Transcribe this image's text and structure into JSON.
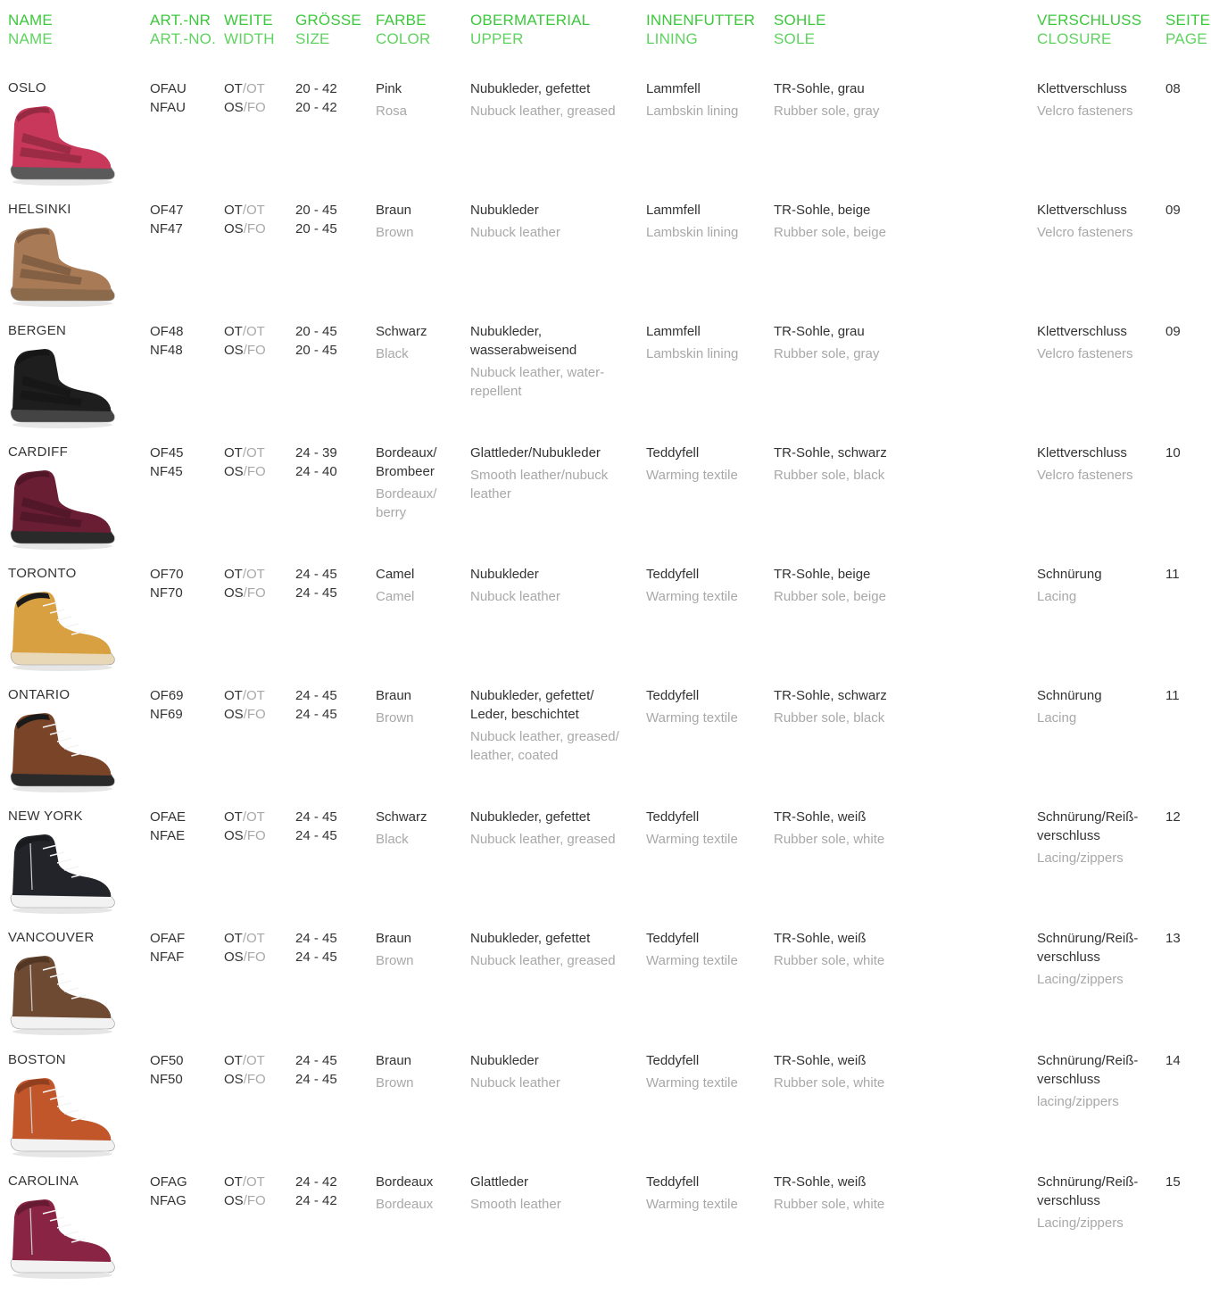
{
  "headers": {
    "name": {
      "de": "NAME",
      "en": "NAME"
    },
    "art": {
      "de": "ART.-NR",
      "en": "ART.-NO."
    },
    "width": {
      "de": "WEITE",
      "en": "WIDTH"
    },
    "size": {
      "de": "GRÖSSE",
      "en": "SIZE"
    },
    "color": {
      "de": "FARBE",
      "en": "COLOR"
    },
    "upper": {
      "de": "OBERMATERIAL",
      "en": "UPPER"
    },
    "lining": {
      "de": "INNENFUTTER",
      "en": "LINING"
    },
    "sole": {
      "de": "SOHLE",
      "en": "SOLE"
    },
    "closure": {
      "de": "VERSCHLUSS",
      "en": "CLOSURE"
    },
    "page": {
      "de": "SEITE",
      "en": "PAGE"
    }
  },
  "width_labels": {
    "ot_a": "OT",
    "ot_b": "OT",
    "os_a": "OS",
    "os_b": "FO",
    "slash": "/"
  },
  "products": [
    {
      "name": "OSLO",
      "art1": "OFAU",
      "art2": "NFAU",
      "size1": "20 - 42",
      "size2": "20 - 42",
      "color_de": "Pink",
      "color_en": "Rosa",
      "upper_de": "Nubukleder, gefettet",
      "upper_en": "Nubuck leather, greased",
      "lining_de": "Lammfell",
      "lining_en": "Lambskin lining",
      "sole_de": "TR-Sohle, grau",
      "sole_en": "Rubber sole, gray",
      "closure_de": "Klettverschluss",
      "closure_en": "Velcro fasteners",
      "page": "08",
      "shoe_color": "#c8385a",
      "sole_color": "#5a5a5a",
      "style": "velcro"
    },
    {
      "name": "HELSINKI",
      "art1": "OF47",
      "art2": "NF47",
      "size1": "20 - 45",
      "size2": "20 - 45",
      "color_de": "Braun",
      "color_en": "Brown",
      "upper_de": "Nubukleder",
      "upper_en": "Nubuck leather",
      "lining_de": "Lammfell",
      "lining_en": "Lambskin lining",
      "sole_de": "TR-Sohle, beige",
      "sole_en": "Rubber sole, beige",
      "closure_de": "Klettverschluss",
      "closure_en": "Velcro fasteners",
      "page": "09",
      "shoe_color": "#a87a56",
      "sole_color": "#8a6a4a",
      "style": "velcro"
    },
    {
      "name": "BERGEN",
      "art1": "OF48",
      "art2": "NF48",
      "size1": "20 - 45",
      "size2": "20 - 45",
      "color_de": "Schwarz",
      "color_en": "Black",
      "upper_de": "Nubukleder, wasserabweisend",
      "upper_en": "Nubuck leather, water-repellent",
      "lining_de": "Lammfell",
      "lining_en": "Lambskin lining",
      "sole_de": "TR-Sohle, grau",
      "sole_en": "Rubber sole, gray",
      "closure_de": "Klettverschluss",
      "closure_en": "Velcro fasteners",
      "page": "09",
      "shoe_color": "#1e1e1e",
      "sole_color": "#444444",
      "style": "velcro"
    },
    {
      "name": "CARDIFF",
      "art1": "OF45",
      "art2": "NF45",
      "size1": "24 - 39",
      "size2": "24 - 40",
      "color_de": "Bordeaux/ Brombeer",
      "color_en": "Bordeaux/ berry",
      "upper_de": "Glattleder/Nubukleder",
      "upper_en": "Smooth leather/nubuck leather",
      "lining_de": "Teddyfell",
      "lining_en": "Warming textile",
      "sole_de": "TR-Sohle, schwarz",
      "sole_en": "Rubber sole, black",
      "closure_de": "Klettverschluss",
      "closure_en": "Velcro fasteners",
      "page": "10",
      "shoe_color": "#6a1e34",
      "sole_color": "#2a2a2a",
      "style": "velcro"
    },
    {
      "name": "TORONTO",
      "art1": "OF70",
      "art2": "NF70",
      "size1": "24 - 45",
      "size2": "24 - 45",
      "color_de": "Camel",
      "color_en": "Camel",
      "upper_de": "Nubukleder",
      "upper_en": "Nubuck leather",
      "lining_de": "Teddyfell",
      "lining_en": "Warming textile",
      "sole_de": "TR-Sohle, beige",
      "sole_en": "Rubber sole, beige",
      "closure_de": "Schnürung",
      "closure_en": "Lacing",
      "page": "11",
      "shoe_color": "#d8a040",
      "sole_color": "#e8d8b8",
      "style": "lace"
    },
    {
      "name": "ONTARIO",
      "art1": "OF69",
      "art2": "NF69",
      "size1": "24 - 45",
      "size2": "24 - 45",
      "color_de": "Braun",
      "color_en": "Brown",
      "upper_de": "Nubukleder, gefettet/ Leder, beschichtet",
      "upper_en": "Nubuck leather, greased/ leather, coated",
      "lining_de": "Teddyfell",
      "lining_en": "Warming textile",
      "sole_de": "TR-Sohle, schwarz",
      "sole_en": "Rubber sole, black",
      "closure_de": "Schnürung",
      "closure_en": "Lacing",
      "page": "11",
      "shoe_color": "#7a4428",
      "sole_color": "#2a2a2a",
      "style": "lace"
    },
    {
      "name": "NEW YORK",
      "art1": "OFAE",
      "art2": "NFAE",
      "size1": "24 - 45",
      "size2": "24 - 45",
      "color_de": "Schwarz",
      "color_en": "Black",
      "upper_de": "Nubukleder, gefettet",
      "upper_en": "Nubuck leather, greased",
      "lining_de": "Teddyfell",
      "lining_en": "Warming textile",
      "sole_de": "TR-Sohle, weiß",
      "sole_en": "Rubber sole, white",
      "closure_de": "Schnürung/Reiß- verschluss",
      "closure_en": "Lacing/zippers",
      "page": "12",
      "shoe_color": "#22242a",
      "sole_color": "#f2f2f2",
      "style": "sneaker"
    },
    {
      "name": "VANCOUVER",
      "art1": "OFAF",
      "art2": "NFAF",
      "size1": "24 - 45",
      "size2": "24 - 45",
      "color_de": "Braun",
      "color_en": "Brown",
      "upper_de": "Nubukleder, gefettet",
      "upper_en": "Nubuck leather, greased",
      "lining_de": "Teddyfell",
      "lining_en": "Warming textile",
      "sole_de": "TR-Sohle, weiß",
      "sole_en": "Rubber sole, white",
      "closure_de": "Schnürung/Reiß- verschluss",
      "closure_en": "Lacing/zippers",
      "page": "13",
      "shoe_color": "#6e4a32",
      "sole_color": "#f2f2f2",
      "style": "sneaker"
    },
    {
      "name": "BOSTON",
      "art1": "OF50",
      "art2": "NF50",
      "size1": "24 - 45",
      "size2": "24 - 45",
      "color_de": "Braun",
      "color_en": "Brown",
      "upper_de": "Nubukleder",
      "upper_en": "Nubuck leather",
      "lining_de": "Teddyfell",
      "lining_en": "Warming textile",
      "sole_de": "TR-Sohle, weiß",
      "sole_en": "Rubber sole, white",
      "closure_de": "Schnürung/Reiß- verschluss",
      "closure_en": "lacing/zippers",
      "page": "14",
      "shoe_color": "#c0562a",
      "sole_color": "#f2f2f2",
      "style": "sneaker"
    },
    {
      "name": "CAROLINA",
      "art1": "OFAG",
      "art2": "NFAG",
      "size1": "24 - 42",
      "size2": "24 - 42",
      "color_de": "Bordeaux",
      "color_en": "Bordeaux",
      "upper_de": "Glattleder",
      "upper_en": "Smooth leather",
      "lining_de": "Teddyfell",
      "lining_en": "Warming textile",
      "sole_de": "TR-Sohle, weiß",
      "sole_en": "Rubber sole, white",
      "closure_de": "Schnürung/Reiß- verschluss",
      "closure_en": "Lacing/zippers",
      "page": "15",
      "shoe_color": "#8a2444",
      "sole_color": "#f2f2f2",
      "style": "sneaker"
    }
  ]
}
